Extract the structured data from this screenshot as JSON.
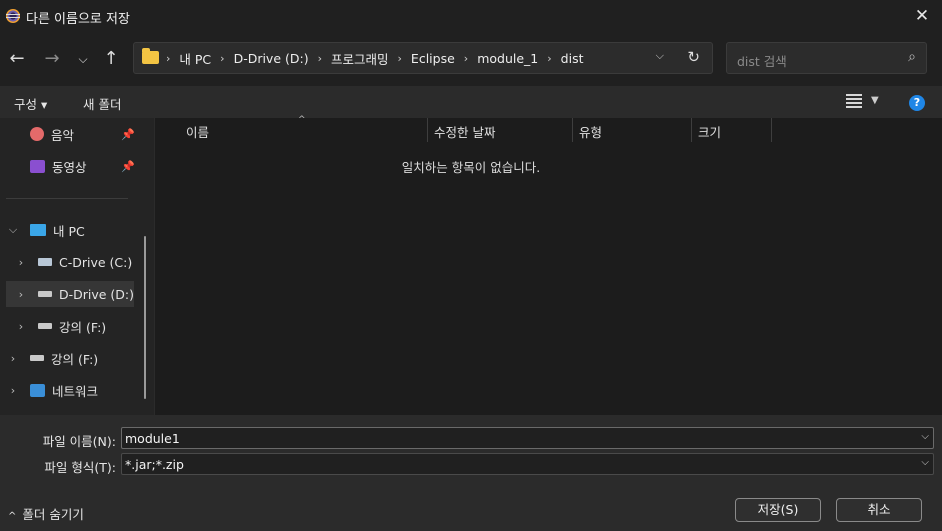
{
  "window": {
    "title": "다른 이름으로 저장"
  },
  "address": {
    "crumbs": [
      "내 PC",
      "D-Drive (D:)",
      "프로그래밍",
      "Eclipse",
      "module_1",
      "dist"
    ]
  },
  "search": {
    "placeholder": "dist 검색"
  },
  "toolbar": {
    "organize": "구성 ▾",
    "new_folder": "새 폴더"
  },
  "sidebar": {
    "items": [
      {
        "label": "음악"
      },
      {
        "label": "동영상"
      },
      {
        "label": "내 PC"
      },
      {
        "label": "C-Drive (C:)"
      },
      {
        "label": "D-Drive (D:)"
      },
      {
        "label": "강의 (F:)"
      },
      {
        "label": "강의 (F:)"
      },
      {
        "label": "네트워크"
      }
    ]
  },
  "columns": {
    "name": "이름",
    "modified": "수정한 날짜",
    "type": "유형",
    "size": "크기"
  },
  "list": {
    "empty_message": "일치하는 항목이 없습니다."
  },
  "form": {
    "filename_label": "파일 이름(N):",
    "filename_value": "module1",
    "filetype_label": "파일 형식(T):",
    "filetype_value": "*.jar;*.zip"
  },
  "footer": {
    "hide_folders": "폴더 숨기기",
    "save": "저장(S)",
    "cancel": "취소"
  }
}
